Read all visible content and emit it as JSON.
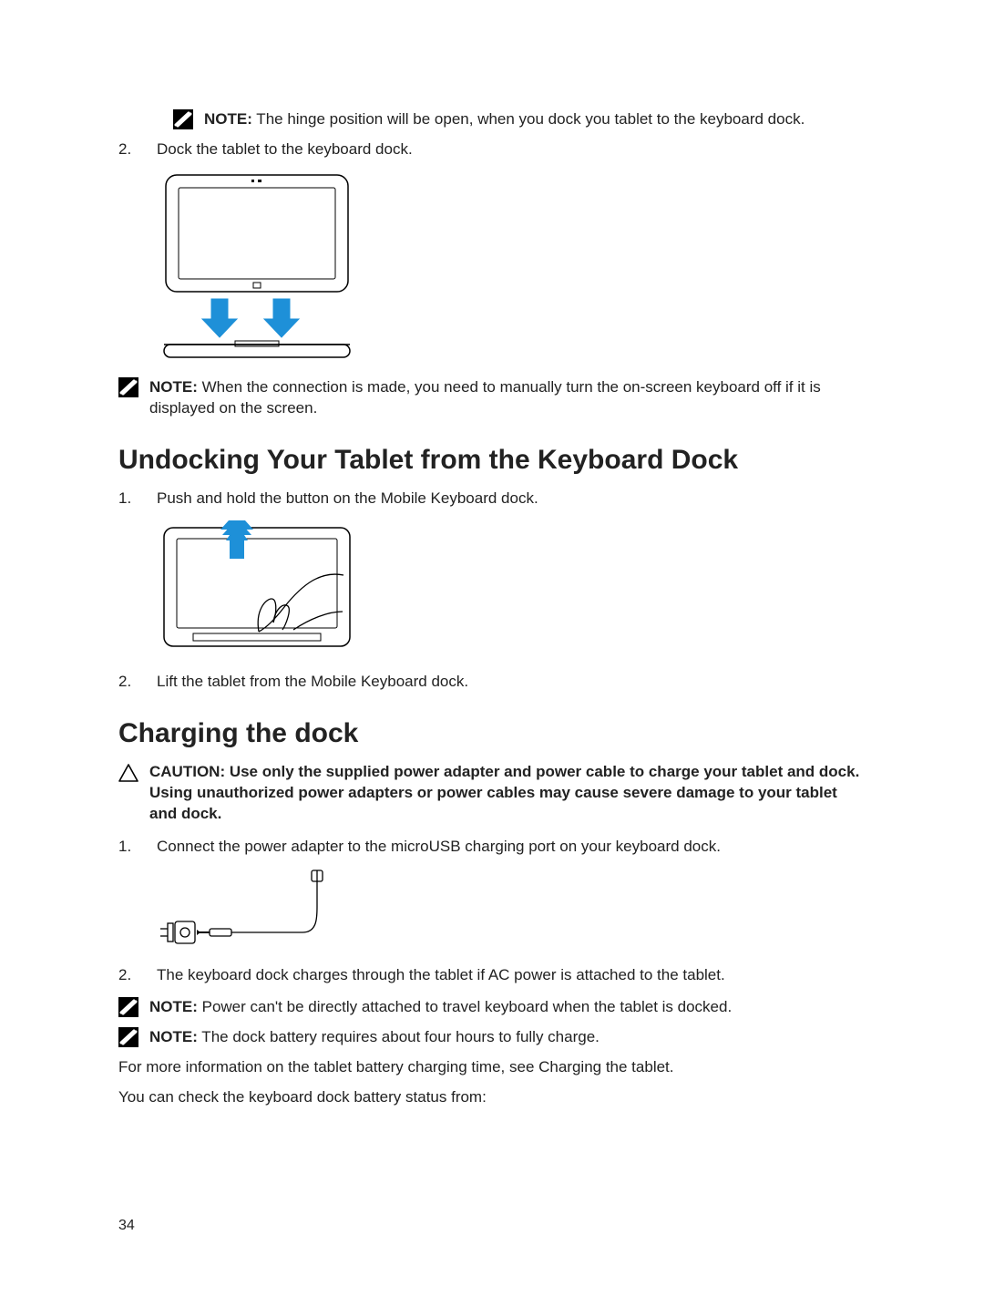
{
  "note1": {
    "label": "NOTE:",
    "text": " The hinge position will be open, when you dock you tablet to the keyboard dock."
  },
  "step2": {
    "num": "2.",
    "text": "Dock the tablet to the keyboard dock."
  },
  "note2": {
    "label": "NOTE:",
    "text": " When the connection is made, you need to manually turn the on-screen keyboard off if it is displayed on the screen."
  },
  "h_undock": "Undocking Your Tablet from the Keyboard Dock",
  "undock_step1": {
    "num": "1.",
    "text": "Push and hold the button on the Mobile Keyboard dock."
  },
  "undock_step2": {
    "num": "2.",
    "text": "Lift the tablet from the Mobile Keyboard dock."
  },
  "h_charge": "Charging the dock",
  "caution": {
    "label": "CAUTION: ",
    "text": "Use only the supplied power adapter and power cable to charge your tablet and dock. Using unauthorized power adapters or power cables may cause severe damage to your tablet and dock."
  },
  "charge_step1": {
    "num": "1.",
    "text": "Connect the power adapter to the microUSB charging port on your keyboard dock."
  },
  "charge_step2": {
    "num": "2.",
    "text": "The keyboard dock charges through the tablet if AC power is attached to the tablet."
  },
  "note3": {
    "label": "NOTE:",
    "text": " Power can't be directly attached to travel keyboard when the tablet is docked."
  },
  "note4": {
    "label": "NOTE:",
    "text": " The dock battery requires about four hours to fully charge."
  },
  "p_more": "For more information on the tablet battery charging time, see Charging the tablet.",
  "p_check": "You can check the keyboard dock battery status from:",
  "page_number": "34"
}
